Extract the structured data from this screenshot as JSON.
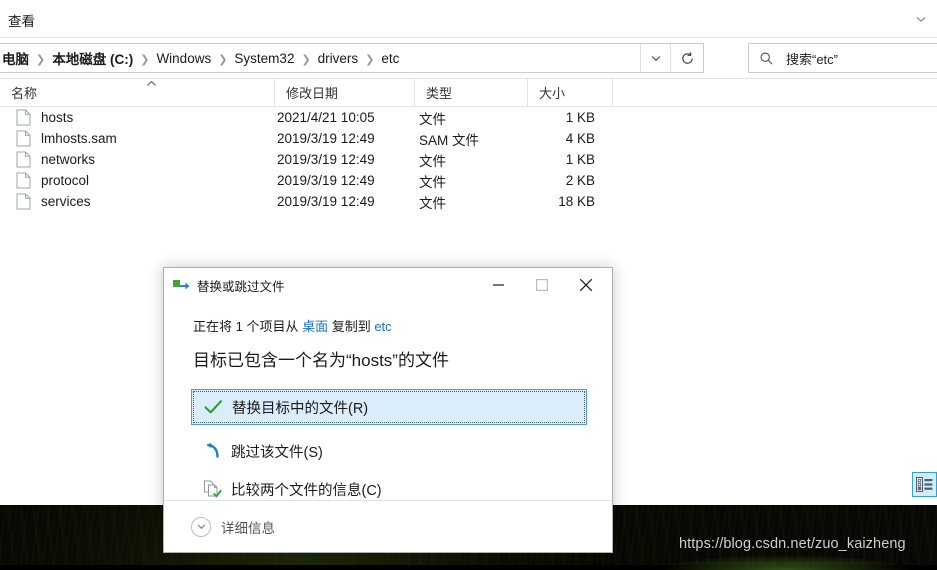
{
  "explorer": {
    "ribbon": {
      "view_menu": "查看",
      "expand_icon": "chevron-down-icon"
    },
    "address": {
      "breadcrumbs": [
        {
          "label": "电脑",
          "bold": true
        },
        {
          "label": "本地磁盘 (C:)",
          "bold": true
        },
        {
          "label": "Windows",
          "bold": false
        },
        {
          "label": "System32",
          "bold": false
        },
        {
          "label": "drivers",
          "bold": false
        },
        {
          "label": "etc",
          "bold": false
        }
      ],
      "separator": "❯",
      "history_icon": "chevron-down-icon",
      "refresh_icon": "refresh-icon",
      "search_icon": "search-icon",
      "search_placeholder": "搜索“etc”"
    },
    "columns": [
      {
        "key": "name",
        "label": "名称"
      },
      {
        "key": "date",
        "label": "修改日期"
      },
      {
        "key": "type",
        "label": "类型"
      },
      {
        "key": "size",
        "label": "大小"
      }
    ],
    "sort_indicator": "ascending-sort-icon",
    "files": [
      {
        "icon": "file-icon",
        "name": "hosts",
        "date": "2021/4/21 10:05",
        "type": "文件",
        "size": "1 KB"
      },
      {
        "icon": "file-icon",
        "name": "lmhosts.sam",
        "date": "2019/3/19 12:49",
        "type": "SAM 文件",
        "size": "4 KB"
      },
      {
        "icon": "file-icon",
        "name": "networks",
        "date": "2019/3/19 12:49",
        "type": "文件",
        "size": "1 KB"
      },
      {
        "icon": "file-icon",
        "name": "protocol",
        "date": "2019/3/19 12:49",
        "type": "文件",
        "size": "2 KB"
      },
      {
        "icon": "file-icon",
        "name": "services",
        "date": "2019/3/19 12:49",
        "type": "文件",
        "size": "18 KB"
      }
    ],
    "view_toggle": {
      "icon": "details-view-icon",
      "accent_color": "#2f9fd8",
      "fill_color": "#d7ecf9"
    }
  },
  "dialog": {
    "icon": "copy-file-icon",
    "title": "替换或跳过文件",
    "window_buttons": {
      "minimize": "minimize-icon",
      "maximize": "maximize-icon",
      "close": "close-icon"
    },
    "subtitle_prefix": "正在将 1 个项目从 ",
    "subtitle_source": "桌面",
    "subtitle_middle": " 复制到 ",
    "subtitle_target": "etc",
    "heading": "目标已包含一个名为“hosts”的文件",
    "options": [
      {
        "icon": "green-check-icon",
        "label": "替换目标中的文件(R)",
        "selected": true
      },
      {
        "icon": "skip-arrow-icon",
        "label": "跳过该文件(S)",
        "selected": false
      },
      {
        "icon": "compare-files-icon",
        "label": "比较两个文件的信息(C)",
        "selected": false
      }
    ],
    "footer": {
      "chevron_icon": "chevron-down-circle-icon",
      "label": "详细信息"
    },
    "selection_color": "#d9edfb",
    "selection_border": "#45a0e0"
  },
  "desktop": {
    "watermark": "https://blog.csdn.net/zuo_kaizheng"
  }
}
